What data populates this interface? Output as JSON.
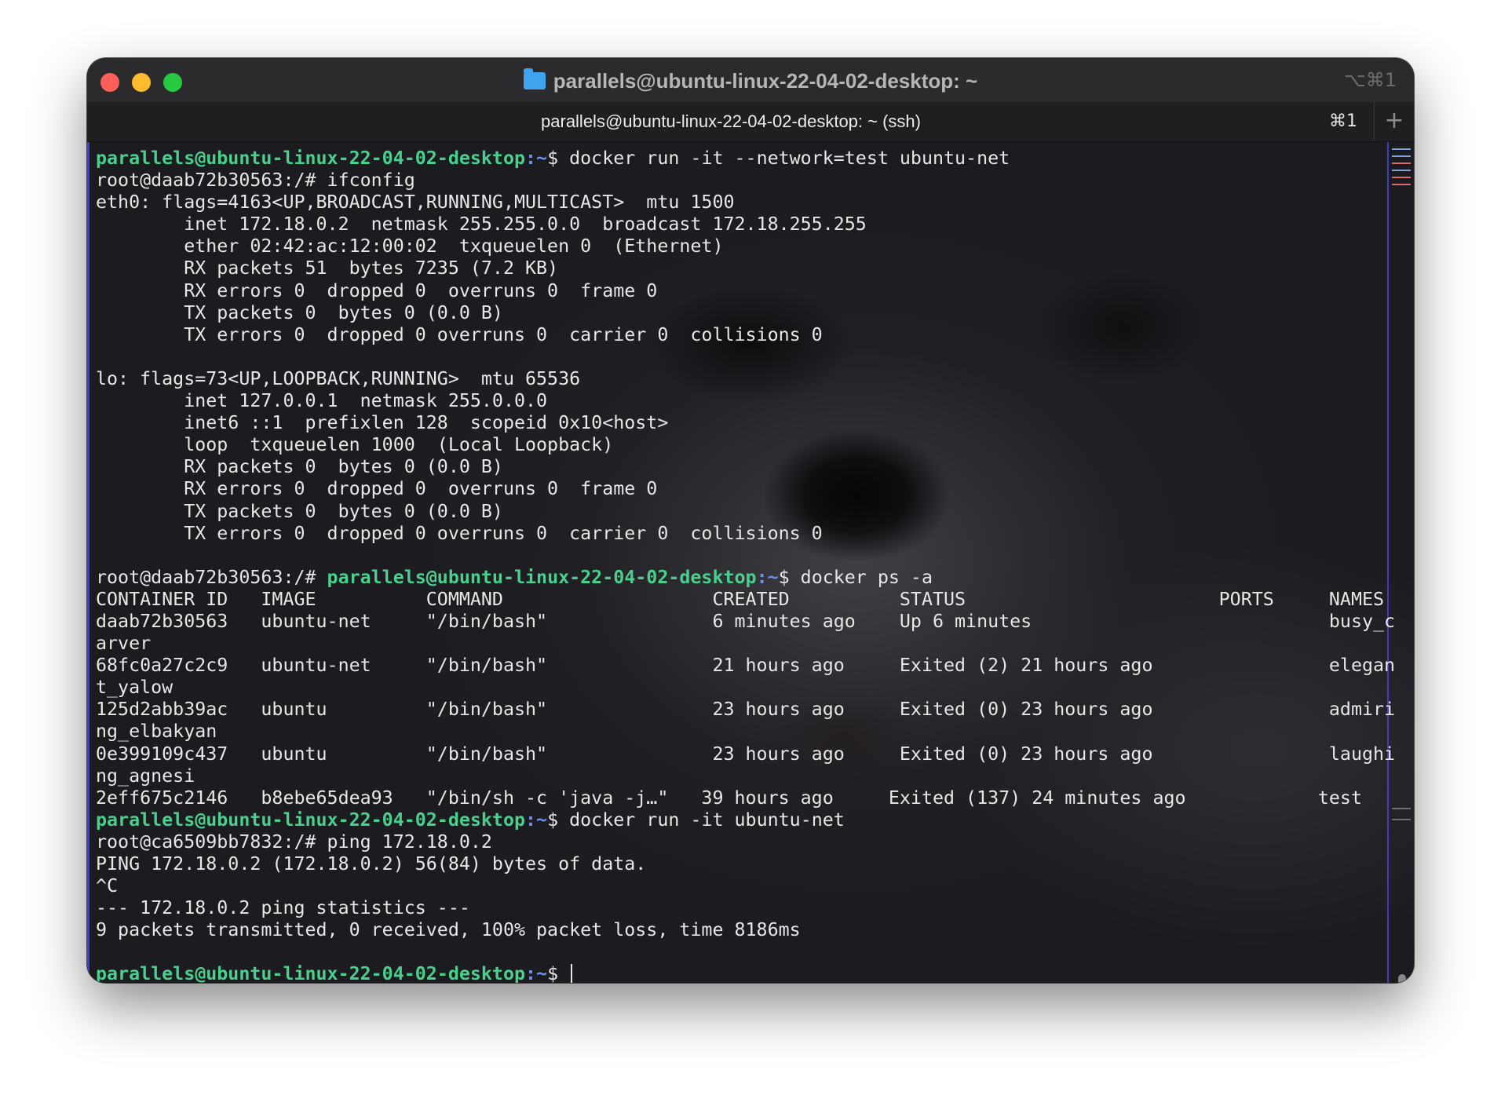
{
  "window": {
    "title": "parallels@ubuntu-linux-22-04-02-desktop: ~",
    "top_shortcut": "⌥⌘1",
    "tab_title": "parallels@ubuntu-linux-22-04-02-desktop: ~ (ssh)",
    "tab_shortcut": "⌘1",
    "new_tab_label": "+",
    "icons": [
      "folder-icon",
      "close-icon",
      "minimize-icon",
      "zoom-icon",
      "plus-icon"
    ]
  },
  "colors": {
    "prompt_user": "#48d08c",
    "prompt_path": "#6d8ef2",
    "text": "#e7e7e7"
  },
  "terminal": {
    "lines": [
      {
        "user": "parallels@ubuntu-linux-22-04-02-desktop",
        "path": ":~",
        "rest": "$ docker run -it --network=test ubuntu-net"
      },
      {
        "text": "root@daab72b30563:/# ifconfig"
      },
      {
        "text": "eth0: flags=4163<UP,BROADCAST,RUNNING,MULTICAST>  mtu 1500"
      },
      {
        "text": "        inet 172.18.0.2  netmask 255.255.0.0  broadcast 172.18.255.255"
      },
      {
        "text": "        ether 02:42:ac:12:00:02  txqueuelen 0  (Ethernet)"
      },
      {
        "text": "        RX packets 51  bytes 7235 (7.2 KB)"
      },
      {
        "text": "        RX errors 0  dropped 0  overruns 0  frame 0"
      },
      {
        "text": "        TX packets 0  bytes 0 (0.0 B)"
      },
      {
        "text": "        TX errors 0  dropped 0 overruns 0  carrier 0  collisions 0"
      },
      {
        "text": ""
      },
      {
        "text": "lo: flags=73<UP,LOOPBACK,RUNNING>  mtu 65536"
      },
      {
        "text": "        inet 127.0.0.1  netmask 255.0.0.0"
      },
      {
        "text": "        inet6 ::1  prefixlen 128  scopeid 0x10<host>"
      },
      {
        "text": "        loop  txqueuelen 1000  (Local Loopback)"
      },
      {
        "text": "        RX packets 0  bytes 0 (0.0 B)"
      },
      {
        "text": "        RX errors 0  dropped 0  overruns 0  frame 0"
      },
      {
        "text": "        TX packets 0  bytes 0 (0.0 B)"
      },
      {
        "text": "        TX errors 0  dropped 0 overruns 0  carrier 0  collisions 0"
      },
      {
        "text": ""
      },
      {
        "pre": "root@daab72b30563:/# ",
        "user": "parallels@ubuntu-linux-22-04-02-desktop",
        "path": ":~",
        "rest": "$ docker ps -a"
      },
      {
        "text": "CONTAINER ID   IMAGE          COMMAND                   CREATED          STATUS                       PORTS     NAMES"
      },
      {
        "text": "daab72b30563   ubuntu-net     \"/bin/bash\"               6 minutes ago    Up 6 minutes                           busy_c"
      },
      {
        "text": "arver"
      },
      {
        "text": "68fc0a27c2c9   ubuntu-net     \"/bin/bash\"               21 hours ago     Exited (2) 21 hours ago                elegan"
      },
      {
        "text": "t_yalow"
      },
      {
        "text": "125d2abb39ac   ubuntu         \"/bin/bash\"               23 hours ago     Exited (0) 23 hours ago                admiri"
      },
      {
        "text": "ng_elbakyan"
      },
      {
        "text": "0e399109c437   ubuntu         \"/bin/bash\"               23 hours ago     Exited (0) 23 hours ago                laughi"
      },
      {
        "text": "ng_agnesi"
      },
      {
        "text": "2eff675c2146   b8ebe65dea93   \"/bin/sh -c 'java -j…\"   39 hours ago     Exited (137) 24 minutes ago            test"
      },
      {
        "user": "parallels@ubuntu-linux-22-04-02-desktop",
        "path": ":~",
        "rest": "$ docker run -it ubuntu-net"
      },
      {
        "text": "root@ca6509bb7832:/# ping 172.18.0.2"
      },
      {
        "text": "PING 172.18.0.2 (172.18.0.2) 56(84) bytes of data."
      },
      {
        "text": "^C"
      },
      {
        "text": "--- 172.18.0.2 ping statistics ---"
      },
      {
        "text": "9 packets transmitted, 0 received, 100% packet loss, time 8186ms"
      },
      {
        "text": ""
      },
      {
        "user": "parallels@ubuntu-linux-22-04-02-desktop",
        "path": ":~",
        "rest": "$ ",
        "cursor": true
      }
    ]
  }
}
